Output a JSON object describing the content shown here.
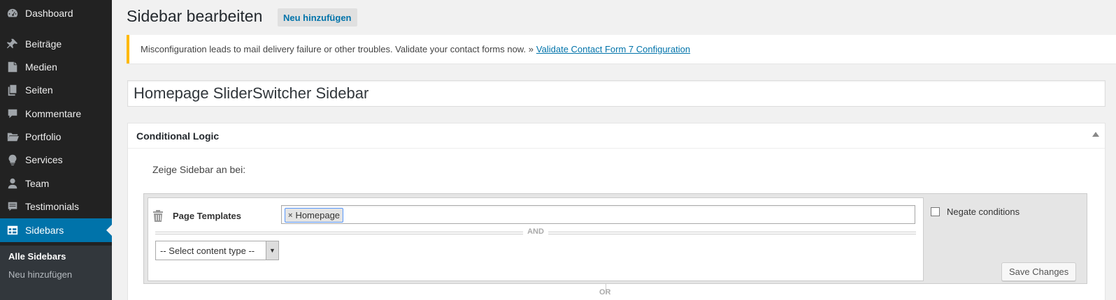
{
  "menu": {
    "items": [
      {
        "label": "Dashboard",
        "icon": "dashboard-icon"
      },
      {
        "label": "Beiträge",
        "icon": "pin-icon"
      },
      {
        "label": "Medien",
        "icon": "media-icon"
      },
      {
        "label": "Seiten",
        "icon": "pages-icon"
      },
      {
        "label": "Kommentare",
        "icon": "comment-icon"
      },
      {
        "label": "Portfolio",
        "icon": "folder-icon"
      },
      {
        "label": "Services",
        "icon": "lightbulb-icon"
      },
      {
        "label": "Team",
        "icon": "user-icon"
      },
      {
        "label": "Testimonials",
        "icon": "testimonial-icon"
      },
      {
        "label": "Sidebars",
        "icon": "table-icon",
        "current": true
      }
    ],
    "submenu": [
      {
        "label": "Alle Sidebars",
        "active": true
      },
      {
        "label": "Neu hinzufügen"
      }
    ],
    "colors": {
      "bg": "#222222",
      "current": "#0073aa",
      "submenu_bg": "#32373c"
    }
  },
  "header": {
    "title": "Sidebar bearbeiten",
    "add_new": "Neu hinzufügen"
  },
  "notice": {
    "text": "Misconfiguration leads to mail delivery failure or other troubles. Validate your contact forms now. »",
    "link": "Validate Contact Form 7 Configuration",
    "accent_color": "#ffb900"
  },
  "title_field": {
    "value": "Homepage SliderSwitcher Sidebar"
  },
  "conditional": {
    "heading": "Conditional Logic",
    "intro": "Zeige Sidebar an bei:",
    "rule": {
      "label": "Page Templates",
      "tags": [
        "Homepage"
      ],
      "tag_remove": "×"
    },
    "and_label": "AND",
    "select_value": "-- Select content type --",
    "select_arrow": "▼",
    "negate_label": "Negate conditions",
    "negate_checked": false,
    "save_label": "Save Changes",
    "or_label": "OR"
  }
}
